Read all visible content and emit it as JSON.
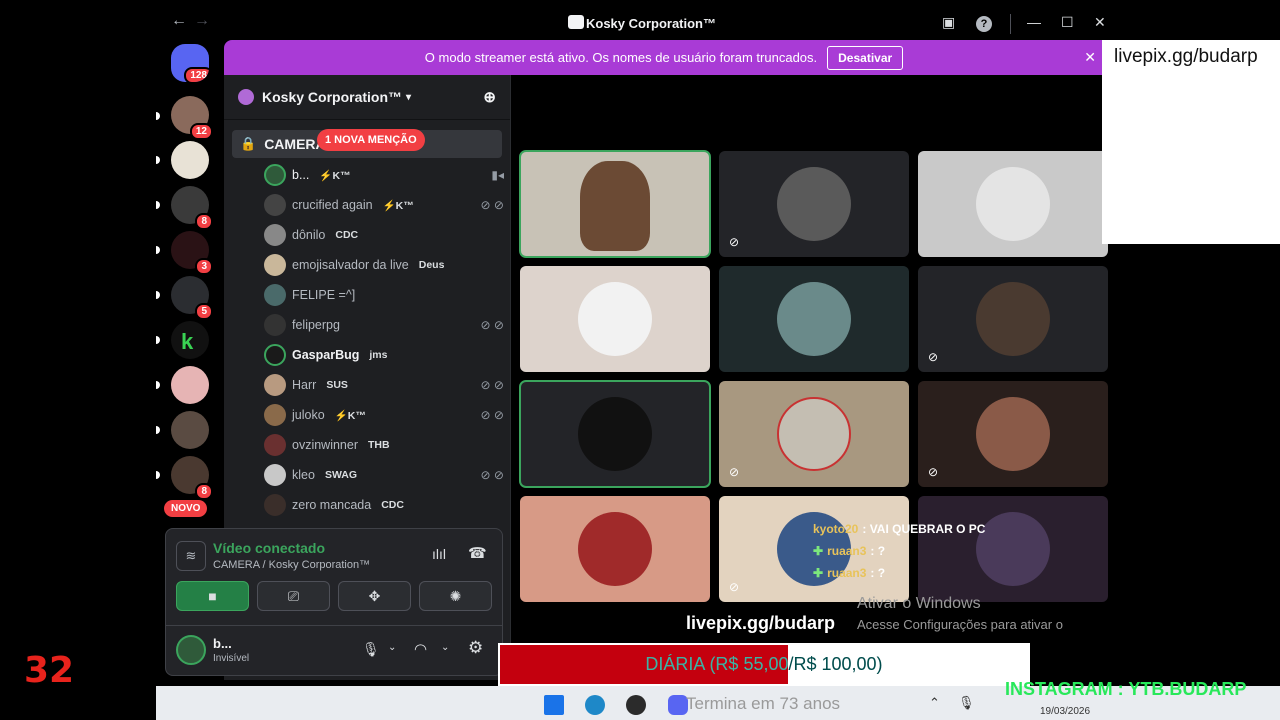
{
  "window": {
    "title": "Kosky Corporation™",
    "nav_back": "←",
    "nav_forward": "→",
    "controls": {
      "inbox": "▣",
      "help": "?",
      "minimize": "—",
      "maximize": "☐",
      "close": "✕"
    }
  },
  "server_rail": {
    "home_badge": "128",
    "badges": [
      "12",
      "8",
      "3",
      "5",
      "8"
    ],
    "new_label": "NOVO"
  },
  "streamer_banner": {
    "message": "O modo streamer está ativo. Os nomes de usuário foram truncados.",
    "button": "Desativar",
    "close": "✕"
  },
  "sidebar": {
    "guild_name": "Kosky Corporation™",
    "channel_name": "CAMERA",
    "mention_pill": "1 NOVA MENÇÃO",
    "members": [
      {
        "name": "b...",
        "tag": "⚡K™"
      },
      {
        "name": "crucified again",
        "tag": "⚡K™"
      },
      {
        "name": "dônilo",
        "tag": "CDC"
      },
      {
        "name": "emojisalvador da live",
        "tag": "Deus"
      },
      {
        "name": "FELIPE =^]",
        "tag": ""
      },
      {
        "name": "feliperpg",
        "tag": ""
      },
      {
        "name": "GasparBug",
        "tag": "jms"
      },
      {
        "name": "Harr",
        "tag": "SUS"
      },
      {
        "name": "juloko",
        "tag": "⚡K™"
      },
      {
        "name": "ovzinwinner",
        "tag": "THB"
      },
      {
        "name": "kleo",
        "tag": "SWAG"
      },
      {
        "name": "zero mancada",
        "tag": "CDC"
      }
    ]
  },
  "voice_panel": {
    "status": "Vídeo conectado",
    "location": "CAMERA / Kosky Corporation™",
    "user_name": "b...",
    "user_status": "Invisível"
  },
  "overlay": {
    "livepix_box": "livepix.gg/budarp",
    "livepix_text": "livepix.gg/budarp",
    "diaria": "DIÁRIA (R$ 55,00/R$ 100,00)",
    "instagram": "INSTAGRAM : YTB.BUDARP",
    "counter": "32",
    "activate_title": "Ativar o Windows",
    "activate_sub": "Acesse Configurações para ativar o",
    "chat": [
      {
        "user": "kyoto20",
        "msg": ": VAI QUEBRAR O PC"
      },
      {
        "user": "ruaan3",
        "msg": ": ?"
      },
      {
        "user": "ruaan3",
        "msg": ": ?"
      }
    ]
  },
  "taskbar": {
    "search_text": "Termina em 73 anos",
    "date": "19/03/2026"
  },
  "colors": {
    "accent_purple": "#a93bd6",
    "green": "#3ba55d",
    "red": "#c4000e",
    "instagram_green": "#28e85a"
  }
}
